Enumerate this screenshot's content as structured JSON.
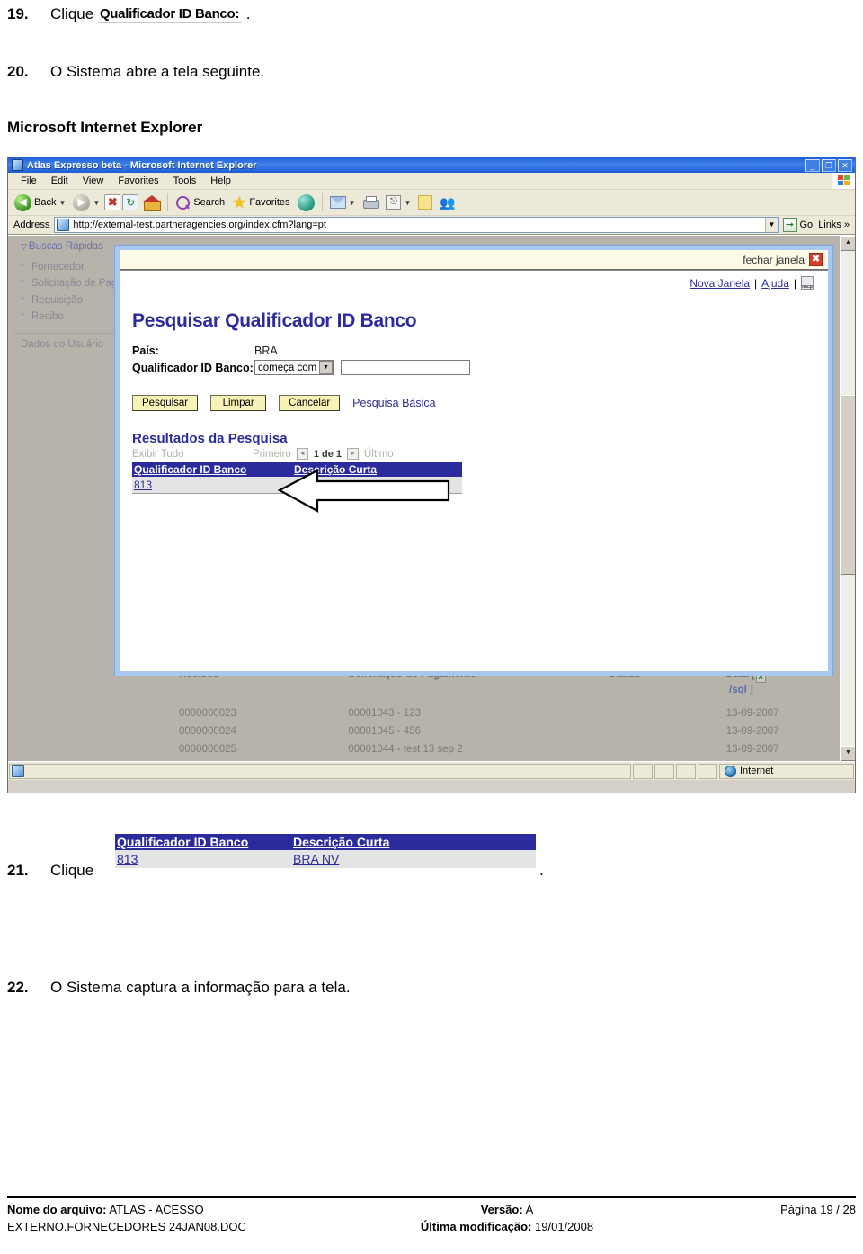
{
  "document": {
    "steps": [
      {
        "num": "19.",
        "prefix": "Clique",
        "inline_label": "Qualificador ID Banco:",
        "suffix": "."
      },
      {
        "num": "20.",
        "text": "O Sistema abre a tela seguinte."
      },
      {
        "num": "21.",
        "prefix": "Clique",
        "suffix": "."
      },
      {
        "num": "22.",
        "text": "O Sistema captura a informação para a tela."
      }
    ],
    "section_heading": "Microsoft Internet Explorer"
  },
  "browser": {
    "title": "Atlas Expresso beta - Microsoft Internet Explorer",
    "window_buttons": {
      "minimize": "_",
      "restore": "❐",
      "close": "✕"
    },
    "menu": [
      "File",
      "Edit",
      "View",
      "Favorites",
      "Tools",
      "Help"
    ],
    "toolbar": {
      "back": "Back",
      "forward": "",
      "stop": "✖",
      "refresh": "↻",
      "home": "",
      "search": "Search",
      "favorites": "Favorites",
      "media": "",
      "mail": "",
      "print": "",
      "edit": "✎",
      "notes": "",
      "messenger": ""
    },
    "address": {
      "label": "Address",
      "url": "http://external-test.partneragencies.org/index.cfm?lang=pt",
      "go_label": "Go",
      "links_label": "Links",
      "links_chevron": "»"
    },
    "status": {
      "zone": "Internet"
    }
  },
  "app": {
    "sidebar": {
      "heading": "Buscas Rápidas",
      "heading_triangle": "▽",
      "items": [
        "Fornecedor",
        "Solicitação de Pagamento",
        "Requisição",
        "Recibo"
      ],
      "footer_item": "Dados do Usuário"
    },
    "background_table": {
      "headers": [
        "Recibos",
        "Solicitação de Pagamento",
        "Status",
        "Data ["
      ],
      "header_suffix": "/sql ]",
      "rows": [
        {
          "recibo": "0000000023",
          "solicitacao": "00001043 - 123",
          "status": "",
          "data": "13-09-2007"
        },
        {
          "recibo": "0000000024",
          "solicitacao": "00001045 - 456",
          "status": "",
          "data": "13-09-2007"
        },
        {
          "recibo": "0000000025",
          "solicitacao": "00001044 - test 13 sep 2",
          "status": "",
          "data": "13-09-2007"
        }
      ]
    }
  },
  "popup": {
    "close_label": "fechar janela",
    "close_icon": "✖",
    "links": {
      "new_window": "Nova Janela",
      "help": "Ajuda",
      "separator": "|",
      "nscp": "nscp"
    },
    "title": "Pesquisar Qualificador ID Banco",
    "form": {
      "country_label": "País:",
      "country_value": "BRA",
      "qualifier_label": "Qualificador ID Banco:",
      "operator_value": "começa com",
      "operator_arrow": "▼",
      "qualifier_input_value": "",
      "qualifier_input_placeholder": ""
    },
    "buttons": {
      "search": "Pesquisar",
      "clear": "Limpar",
      "cancel": "Cancelar",
      "basic_search_link": "Pesquisa Básica"
    },
    "results": {
      "title": "Resultados da Pesquisa",
      "show_all": "Exibir Tudo",
      "first": "Primeiro",
      "prev_icon": "◄",
      "page_indicator": "1 de 1",
      "next_icon": "►",
      "last": "Último",
      "headers": [
        "Qualificador ID Banco",
        "Descrição Curta"
      ],
      "rows": [
        {
          "id": "813",
          "desc": "BRA NV"
        }
      ]
    }
  },
  "footer": {
    "filename_label": "Nome do arquivo:",
    "filename_value": "ATLAS - ACESSO EXTERNO.FORNECEDORES 24JAN08.DOC",
    "version_label": "Versão:",
    "version_value": "A",
    "modified_label": "Última modificação:",
    "modified_value": "19/01/2008",
    "page_label": "Página 19 / 28"
  }
}
